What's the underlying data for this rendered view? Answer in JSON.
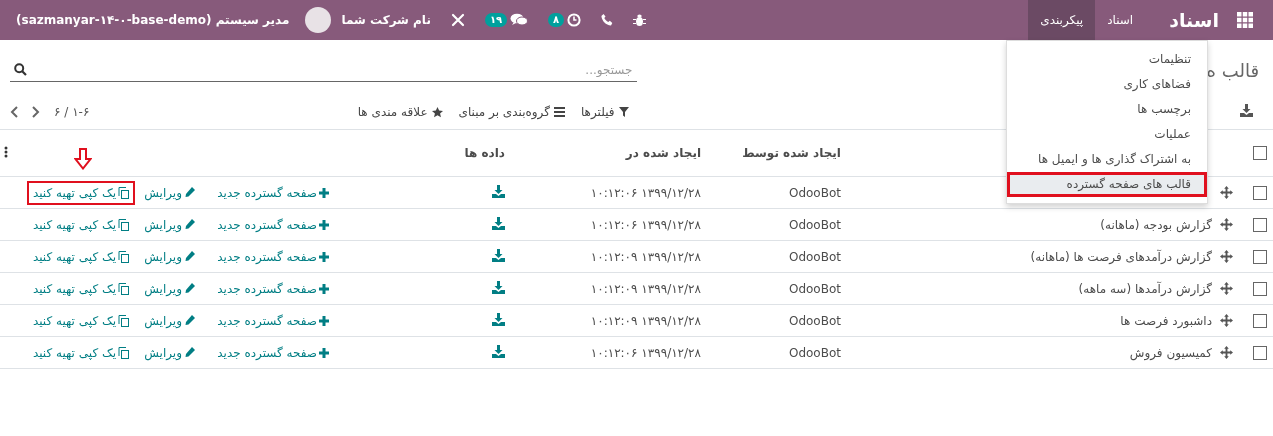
{
  "navbar": {
    "brand": "اسناد",
    "menus": [
      {
        "label": "اسناد",
        "selected": false
      },
      {
        "label": "پیکربندی",
        "selected": true
      }
    ],
    "systray": [
      {
        "kind": "debug"
      },
      {
        "kind": "phone"
      },
      {
        "kind": "activity",
        "badge": "۸"
      },
      {
        "kind": "messages",
        "badge": "۱۹"
      },
      {
        "kind": "tools"
      }
    ],
    "company": "نام شرکت شما",
    "user": "مدیر سیستم (sazmanyar-۱۴-۰-base-demo)"
  },
  "dropdown": {
    "items": [
      {
        "label": "تنظیمات",
        "selected": false,
        "highlighted": false
      },
      {
        "label": "فضاهای کاری",
        "selected": false,
        "highlighted": false
      },
      {
        "label": "برچسب ها",
        "selected": false,
        "highlighted": false
      },
      {
        "label": "عملیات",
        "selected": false,
        "highlighted": false
      },
      {
        "label": "به اشتراک گذاری ها و ایمیل ها",
        "selected": false,
        "highlighted": false
      },
      {
        "label": "قالب های صفحه گسترده",
        "selected": true,
        "highlighted": true
      }
    ]
  },
  "breadcrumb": "قالب ه",
  "search": {
    "placeholder": "جستجو..."
  },
  "filters": [
    {
      "kind": "filter",
      "label": "فیلترها"
    },
    {
      "kind": "group",
      "label": "گروه‌بندی بر مبنای"
    },
    {
      "kind": "favorite",
      "label": "علاقه مندی ها"
    }
  ],
  "pager": "۱-۶ / ۶",
  "table": {
    "select_all_checked": false,
    "columns": [
      "ایجاد شده توسط",
      "ایجاد شده در",
      "داده ها"
    ],
    "rows": [
      {
        "checked": false,
        "created_by": "OdooBot",
        "created_on": "۱۳۹۹/۱۲/۲۸ ۱۰:۱۲:۰۶",
        "actions": [
          {
            "kind": "new",
            "label": "صفحه گسترده جدید",
            "highlighted": false
          },
          {
            "kind": "edit",
            "label": "ویرایش",
            "highlighted": false
          },
          {
            "kind": "copy",
            "label": "یک کپی تهیه کنید",
            "highlighted": true
          }
        ]
      },
      {
        "checked": false,
        "name": "گزارش بودجه (ماهانه)",
        "created_by": "OdooBot",
        "created_on": "۱۳۹۹/۱۲/۲۸ ۱۰:۱۲:۰۶",
        "actions": [
          {
            "kind": "new",
            "label": "صفحه گسترده جدید",
            "highlighted": false
          },
          {
            "kind": "edit",
            "label": "ویرایش",
            "highlighted": false
          },
          {
            "kind": "copy",
            "label": "یک کپی تهیه کنید",
            "highlighted": false
          }
        ]
      },
      {
        "checked": false,
        "name": "گزارش درآمدهای فرصت ها (ماهانه)",
        "created_by": "OdooBot",
        "created_on": "۱۳۹۹/۱۲/۲۸ ۱۰:۱۲:۰۹",
        "actions": [
          {
            "kind": "new",
            "label": "صفحه گسترده جدید",
            "highlighted": false
          },
          {
            "kind": "edit",
            "label": "ویرایش",
            "highlighted": false
          },
          {
            "kind": "copy",
            "label": "یک کپی تهیه کنید",
            "highlighted": false
          }
        ]
      },
      {
        "checked": false,
        "name": "گزارش درآمدها (سه ماهه)",
        "created_by": "OdooBot",
        "created_on": "۱۳۹۹/۱۲/۲۸ ۱۰:۱۲:۰۹",
        "actions": [
          {
            "kind": "new",
            "label": "صفحه گسترده جدید",
            "highlighted": false
          },
          {
            "kind": "edit",
            "label": "ویرایش",
            "highlighted": false
          },
          {
            "kind": "copy",
            "label": "یک کپی تهیه کنید",
            "highlighted": false
          }
        ]
      },
      {
        "checked": false,
        "name": "داشبورد فرصت ها",
        "created_by": "OdooBot",
        "created_on": "۱۳۹۹/۱۲/۲۸ ۱۰:۱۲:۰۹",
        "actions": [
          {
            "kind": "new",
            "label": "صفحه گسترده جدید",
            "highlighted": false
          },
          {
            "kind": "edit",
            "label": "ویرایش",
            "highlighted": false
          },
          {
            "kind": "copy",
            "label": "یک کپی تهیه کنید",
            "highlighted": false
          }
        ]
      },
      {
        "checked": false,
        "name": "کمیسیون فروش",
        "created_by": "OdooBot",
        "created_on": "۱۳۹۹/۱۲/۲۸ ۱۰:۱۲:۰۶",
        "actions": [
          {
            "kind": "new",
            "label": "صفحه گسترده جدید",
            "highlighted": false
          },
          {
            "kind": "edit",
            "label": "ویرایش",
            "highlighted": false
          },
          {
            "kind": "copy",
            "label": "یک کپی تهیه کنید",
            "highlighted": false
          }
        ]
      }
    ]
  }
}
